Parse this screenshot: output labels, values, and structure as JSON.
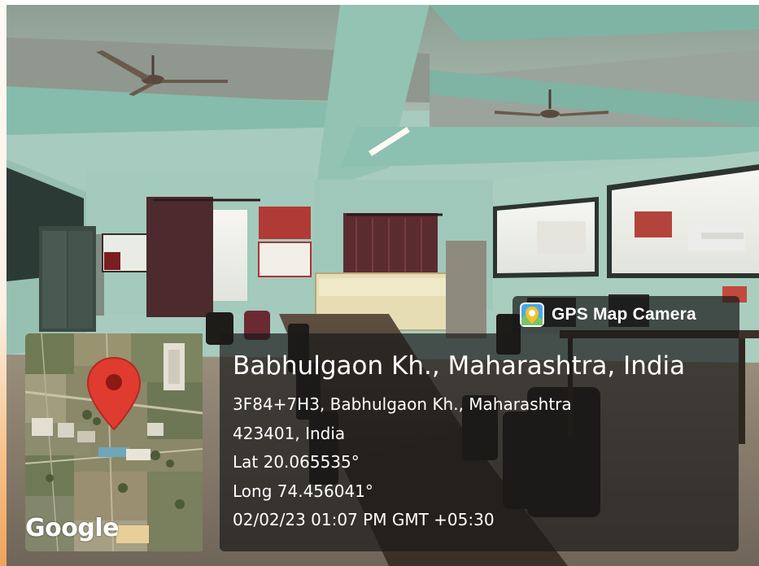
{
  "overlay": {
    "app_badge": "GPS Map Camera",
    "place_title": "Babhulgaon Kh., Maharashtra, India",
    "address_line1": "3F84+7H3, Babhulgaon Kh., Maharashtra",
    "address_line2": "423401, India",
    "latitude": "Lat 20.065535°",
    "longitude": "Long 74.456041°",
    "datetime": "02/02/23 01:07 PM GMT +05:30",
    "map_logo": "Google"
  },
  "icons": {
    "app_badge_icon": "map-pin-app-icon",
    "map_marker_icon": "red-location-pin-icon"
  },
  "colors": {
    "overlay_bg": "#191919",
    "pin_red": "#e03b2f",
    "wall_mint": "#a7cbbf"
  }
}
